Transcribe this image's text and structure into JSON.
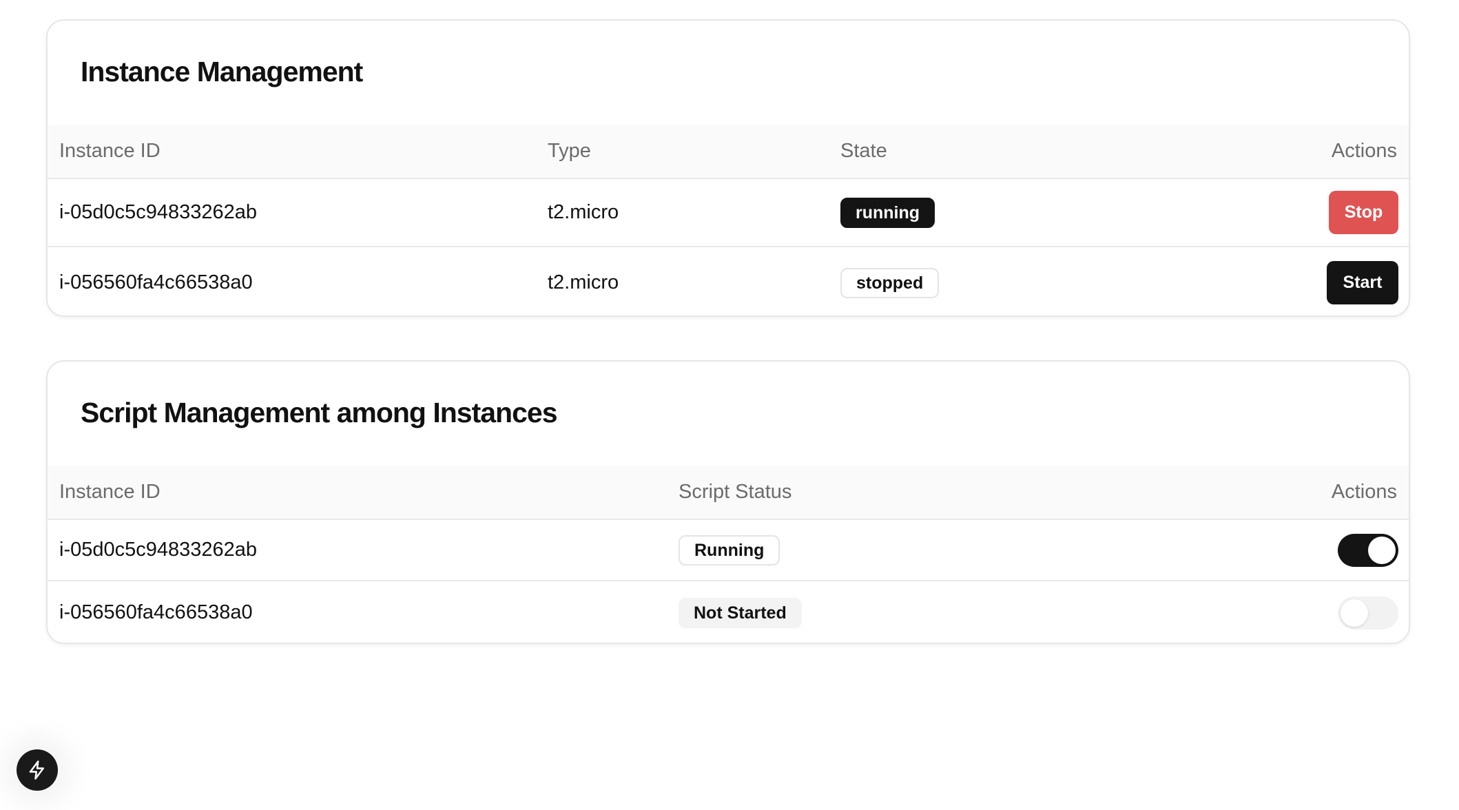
{
  "instance_management": {
    "title": "Instance Management",
    "headers": {
      "instance_id": "Instance ID",
      "type": "Type",
      "state": "State",
      "actions": "Actions"
    },
    "rows": [
      {
        "instance_id": "i-05d0c5c94833262ab",
        "type": "t2.micro",
        "state": "running",
        "action": "Stop"
      },
      {
        "instance_id": "i-056560fa4c66538a0",
        "type": "t2.micro",
        "state": "stopped",
        "action": "Start"
      }
    ]
  },
  "script_management": {
    "title": "Script Management among Instances",
    "headers": {
      "instance_id": "Instance ID",
      "script_status": "Script Status",
      "actions": "Actions"
    },
    "rows": [
      {
        "instance_id": "i-05d0c5c94833262ab",
        "script_status": "Running",
        "toggle_on": true
      },
      {
        "instance_id": "i-056560fa4c66538a0",
        "script_status": "Not Started",
        "toggle_on": false
      }
    ]
  },
  "colors": {
    "stop_button": "#e05353",
    "primary_dark": "#141414",
    "header_bg": "#fafafa"
  },
  "icons": {
    "fab": "lightning-bolt-icon"
  }
}
